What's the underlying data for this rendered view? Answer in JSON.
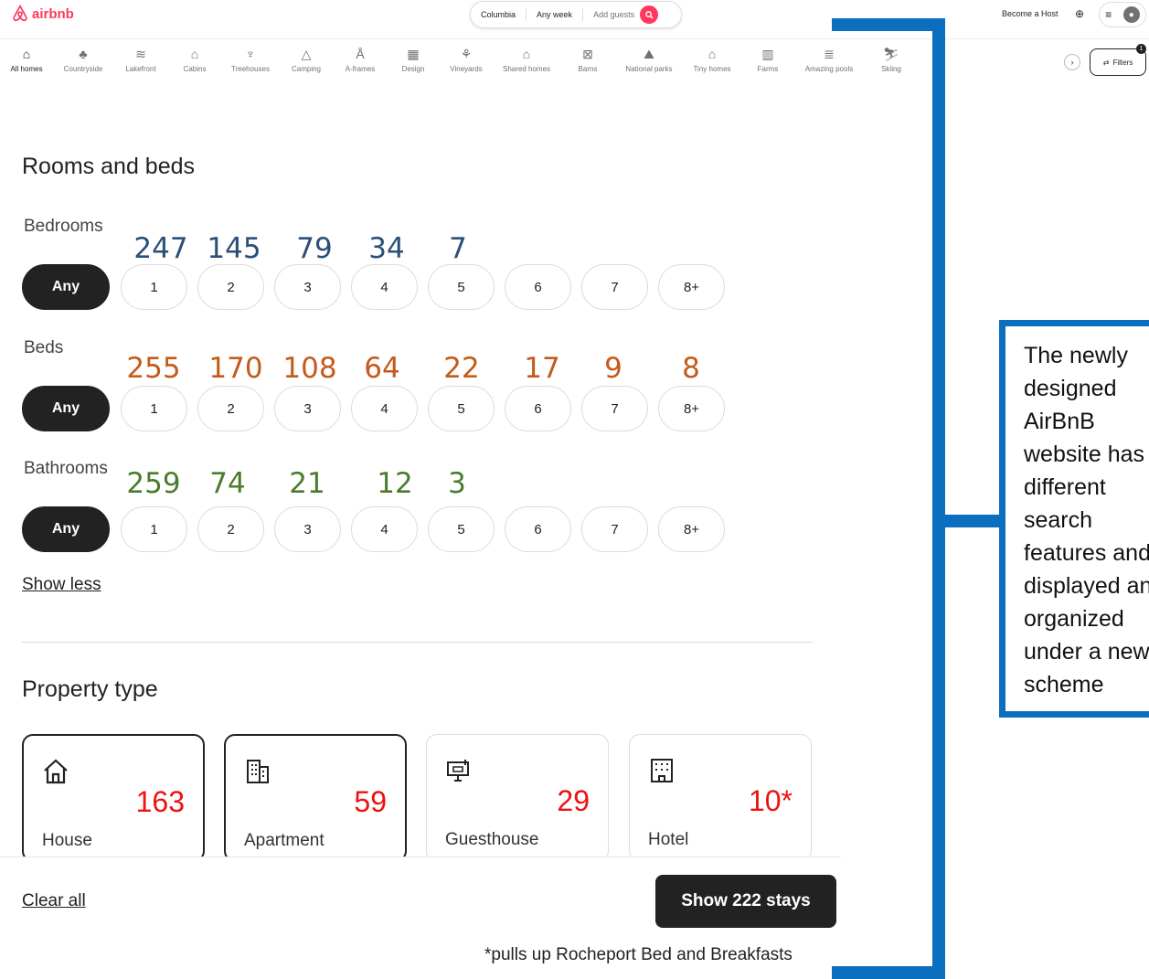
{
  "header": {
    "logo_text": "airbnb",
    "search": {
      "location": "Columbia",
      "dates": "Any week",
      "guests_placeholder": "Add guests"
    },
    "become_host": "Become a Host",
    "filters_label": "Filters",
    "filters_badge": "1"
  },
  "categories": [
    {
      "label": "All homes",
      "icon": "house-icon"
    },
    {
      "label": "Countryside",
      "icon": "countryside-icon"
    },
    {
      "label": "Lakefront",
      "icon": "lakefront-icon"
    },
    {
      "label": "Cabins",
      "icon": "cabin-icon"
    },
    {
      "label": "Treehouses",
      "icon": "treehouse-icon"
    },
    {
      "label": "Camping",
      "icon": "camping-icon"
    },
    {
      "label": "A-frames",
      "icon": "aframe-icon"
    },
    {
      "label": "Design",
      "icon": "design-icon"
    },
    {
      "label": "Vineyards",
      "icon": "vineyard-icon"
    },
    {
      "label": "Shared homes",
      "icon": "shared-home-icon"
    },
    {
      "label": "Barns",
      "icon": "barn-icon"
    },
    {
      "label": "National parks",
      "icon": "national-park-icon"
    },
    {
      "label": "Tiny homes",
      "icon": "tiny-home-icon"
    },
    {
      "label": "Farms",
      "icon": "farm-icon"
    },
    {
      "label": "Amazing pools",
      "icon": "pool-icon"
    },
    {
      "label": "Skiing",
      "icon": "skiing-icon"
    }
  ],
  "rooms": {
    "title": "Rooms and beds",
    "any_label": "Any",
    "options": [
      "1",
      "2",
      "3",
      "4",
      "5",
      "6",
      "7",
      "8+"
    ],
    "bedrooms": {
      "label": "Bedrooms",
      "counts": [
        "247",
        "145",
        "79",
        "34",
        "7"
      ]
    },
    "beds": {
      "label": "Beds",
      "counts": [
        "255",
        "170",
        "108",
        "64",
        "22",
        "17",
        "9",
        "8"
      ]
    },
    "bathrooms": {
      "label": "Bathrooms",
      "counts": [
        "259",
        "74",
        "21",
        "12",
        "3"
      ]
    },
    "show_less": "Show less"
  },
  "property": {
    "title": "Property type",
    "cards": [
      {
        "label": "House",
        "count": "163",
        "icon": "house-icon",
        "selected": true
      },
      {
        "label": "Apartment",
        "count": "59",
        "icon": "apartment-icon",
        "selected": true
      },
      {
        "label": "Guesthouse",
        "count": "29",
        "icon": "guesthouse-icon",
        "selected": false
      },
      {
        "label": "Hotel",
        "count": "10*",
        "icon": "hotel-icon",
        "selected": false
      }
    ]
  },
  "footer": {
    "clear_all": "Clear all",
    "show_stays": "Show 222 stays",
    "footnote": "*pulls up Rocheport Bed and Breakfasts"
  },
  "annotation": {
    "lines": [
      "The newly",
      "designed",
      "AirBnB",
      "website has",
      "different",
      "search",
      "features and",
      "displayed and",
      "organized",
      "under a new",
      "scheme"
    ]
  },
  "colors": {
    "brand": "#ff385c",
    "bedroom_counts": "#2b4f78",
    "bed_counts": "#c55a1a",
    "bathroom_counts": "#4a7c2d",
    "property_counts": "#ee1111",
    "annotation_blue": "#0b6ebf"
  }
}
